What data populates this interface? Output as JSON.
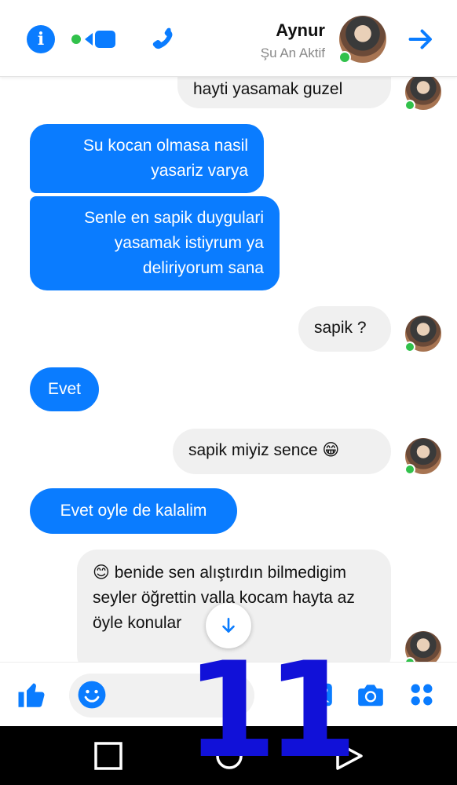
{
  "header": {
    "name": "Aynur",
    "status": "Şu An Aktif"
  },
  "messages": [
    {
      "side": "received",
      "text": "hayti yasamak guzel"
    },
    {
      "side": "sent",
      "text": "Su kocan olmasa nasil yasariz varya"
    },
    {
      "side": "sent",
      "text": "Senle en sapik duygulari yasamak istiyrum ya deliriyorum sana"
    },
    {
      "side": "received",
      "text": "sapik ?"
    },
    {
      "side": "sent",
      "text": "Evet"
    },
    {
      "side": "received",
      "text": "sapik miyiz sence 😁"
    },
    {
      "side": "sent",
      "text": "Evet oyle de kalalim"
    },
    {
      "side": "received",
      "text": "😊 benide sen alıştırdın bilmedigim seyler öğrettin valla kocam hayta   az öyle konular"
    }
  ],
  "overlay": {
    "number": "11"
  },
  "colors": {
    "accent": "#0a7cff",
    "received_bubble": "#f0f0f0",
    "online": "#31c14b",
    "overlay": "#1111d8"
  },
  "icons": [
    "info-icon",
    "video-call-icon",
    "phone-icon",
    "forward-arrow-icon",
    "like-icon",
    "emoji-icon",
    "image-icon",
    "camera-icon",
    "more-icon",
    "scroll-down-icon"
  ]
}
